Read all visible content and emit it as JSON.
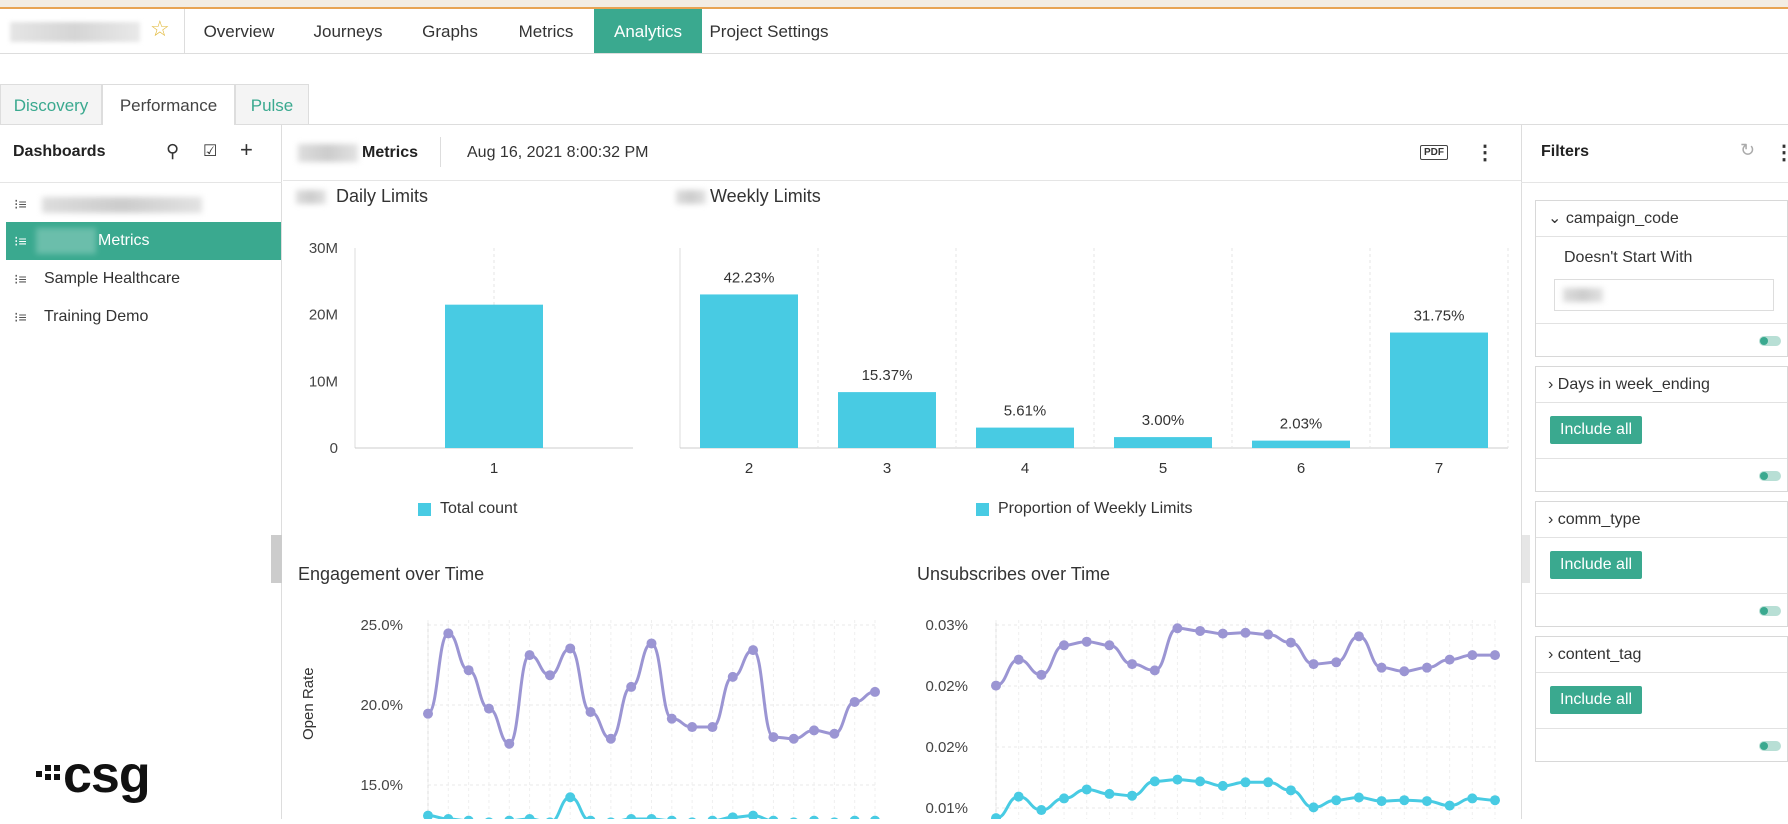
{
  "header": {
    "tabs": [
      {
        "label": "Overview"
      },
      {
        "label": "Journeys"
      },
      {
        "label": "Graphs"
      },
      {
        "label": "Metrics"
      },
      {
        "label": "Analytics",
        "active": true
      },
      {
        "label": "Project Settings"
      }
    ]
  },
  "subtabs": [
    {
      "label": "Discovery"
    },
    {
      "label": "Performance",
      "active": true
    },
    {
      "label": "Pulse"
    }
  ],
  "sidebar": {
    "title": "Dashboards",
    "items": [
      {
        "label": ""
      },
      {
        "label": "Metrics",
        "selected": true
      },
      {
        "label": "Sample Healthcare"
      },
      {
        "label": "Training Demo"
      }
    ]
  },
  "main": {
    "dashboard_title": "Metrics",
    "timestamp": "Aug 16, 2021 8:00:32 PM",
    "pdf_label": "PDF"
  },
  "chart_data": [
    {
      "type": "bar",
      "title": "Daily Limits",
      "categories": [
        "1"
      ],
      "series": [
        {
          "name": "Total count",
          "values": [
            21500000
          ]
        }
      ],
      "ylim": [
        0,
        30000000
      ],
      "yticks": [
        "30M",
        "20M",
        "10M",
        "0"
      ]
    },
    {
      "type": "bar",
      "title": "Weekly Limits",
      "categories": [
        "2",
        "3",
        "4",
        "5",
        "6",
        "7"
      ],
      "series": [
        {
          "name": "Proportion of Weekly Limits",
          "values": [
            42.23,
            15.37,
            5.61,
            3.0,
            2.03,
            31.75
          ]
        }
      ],
      "data_labels": [
        "42.23%",
        "15.37%",
        "5.61%",
        "3.00%",
        "2.03%",
        "31.75%"
      ]
    },
    {
      "type": "line",
      "title": "Engagement over Time",
      "ylabel": "Open Rate",
      "yticks": [
        "25.0%",
        "20.0%",
        "15.0%"
      ],
      "ylim": [
        13.0,
        25.5
      ],
      "series": [
        {
          "values": [
            19.3,
            24.1,
            21.9,
            19.6,
            17.5,
            22.8,
            21.6,
            23.2,
            19.4,
            17.8,
            20.9,
            23.5,
            19.0,
            18.5,
            18.5,
            21.5,
            23.1,
            17.9,
            17.8,
            18.3,
            18.1,
            20.0,
            20.6
          ]
        },
        {
          "values": [
            13.2,
            13.0,
            12.9,
            12.8,
            12.9,
            13.0,
            12.8,
            14.3,
            12.9,
            12.8,
            13.0,
            13.0,
            12.9,
            12.8,
            12.9,
            13.1,
            13.2,
            12.9,
            12.8,
            12.9,
            12.8,
            12.9,
            12.9
          ]
        }
      ]
    },
    {
      "type": "line",
      "title": "Unsubscribes over Time",
      "yticks": [
        "0.03%",
        "0.02%",
        "0.02%",
        "0.01%"
      ],
      "ylim": [
        0.0085,
        0.0305
      ],
      "series": [
        {
          "values": [
            0.0234,
            0.0263,
            0.0246,
            0.0279,
            0.0283,
            0.0279,
            0.0258,
            0.0251,
            0.0298,
            0.0295,
            0.0292,
            0.0293,
            0.0291,
            0.0282,
            0.0258,
            0.026,
            0.0289,
            0.0254,
            0.025,
            0.0254,
            0.0263,
            0.0268,
            0.0268
          ]
        },
        {
          "values": [
            0.0086,
            0.011,
            0.0095,
            0.0108,
            0.0118,
            0.0113,
            0.0111,
            0.0127,
            0.0129,
            0.0127,
            0.0122,
            0.0126,
            0.0126,
            0.0117,
            0.0098,
            0.0106,
            0.0109,
            0.0105,
            0.0106,
            0.0105,
            0.01,
            0.0108,
            0.0106
          ]
        }
      ]
    }
  ],
  "filters": {
    "title": "Filters",
    "items": [
      {
        "name": "campaign_code",
        "condition": "Doesn't Start With",
        "value": ""
      },
      {
        "name": "Days in week_ending",
        "button": "Include all"
      },
      {
        "name": "comm_type",
        "button": "Include all"
      },
      {
        "name": "content_tag",
        "button": "Include all"
      }
    ]
  },
  "logo": "csg",
  "colors": {
    "accent": "#3aa98f",
    "bar": "#48cbe3",
    "line_purple": "#9b95d3",
    "line_cyan": "#48cbe3"
  }
}
